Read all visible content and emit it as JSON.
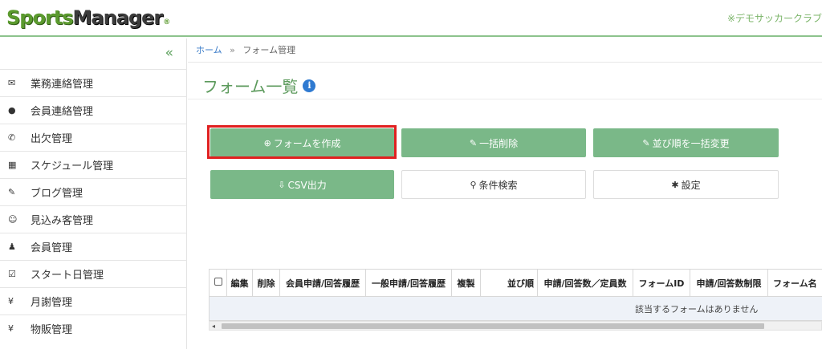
{
  "header": {
    "logo_part1": "Sports",
    "logo_part2": "Manager",
    "logo_reg": "®",
    "club_name": "※デモサッカークラブ"
  },
  "sidebar": {
    "collapse_glyph": "«",
    "items": [
      {
        "label": "業務連絡管理",
        "icon": "envelope-icon",
        "glyph": "✉"
      },
      {
        "label": "会員連絡管理",
        "icon": "comment-icon",
        "glyph": "●"
      },
      {
        "label": "出欠管理",
        "icon": "phone-icon",
        "glyph": "✆"
      },
      {
        "label": "スケジュール管理",
        "icon": "calendar-icon",
        "glyph": "▦"
      },
      {
        "label": "ブログ管理",
        "icon": "pencil-icon",
        "glyph": "✎"
      },
      {
        "label": "見込み客管理",
        "icon": "smile-icon",
        "glyph": "☺"
      },
      {
        "label": "会員管理",
        "icon": "user-icon",
        "glyph": "♟"
      },
      {
        "label": "スタート日管理",
        "icon": "checkbox-icon",
        "glyph": "☑"
      },
      {
        "label": "月謝管理",
        "icon": "yen-icon",
        "glyph": "¥"
      },
      {
        "label": "物販管理",
        "icon": "yen-icon",
        "glyph": "¥"
      }
    ]
  },
  "breadcrumb": {
    "home": "ホーム",
    "separator": "»",
    "current": "フォーム管理"
  },
  "page": {
    "title": "フォーム一覧",
    "info_glyph": "i"
  },
  "buttons": {
    "create": {
      "label": "フォームを作成",
      "glyph": "⊕"
    },
    "bulk_delete": {
      "label": "一括削除",
      "glyph": "✎"
    },
    "bulk_reorder": {
      "label": "並び順を一括変更",
      "glyph": "✎"
    },
    "csv": {
      "label": "CSV出力",
      "glyph": "⇩"
    },
    "search": {
      "label": "条件検索",
      "glyph": "⚲"
    },
    "settings": {
      "label": "設定",
      "glyph": "✱"
    }
  },
  "table": {
    "headers": [
      "編集",
      "削除",
      "会員申請/回答履歴",
      "一般申請/回答履歴",
      "複製",
      "並び順",
      "申請/回答数／定員数",
      "フォームID",
      "申請/回答数制限",
      "フォーム名"
    ],
    "empty_message": "該当するフォームはありません",
    "scroll_left_glyph": "◂"
  },
  "colors": {
    "accent_green": "#7ab888",
    "title_green": "#5c9a5c",
    "highlight_red": "#e02020",
    "link_blue": "#3a7bc8"
  }
}
